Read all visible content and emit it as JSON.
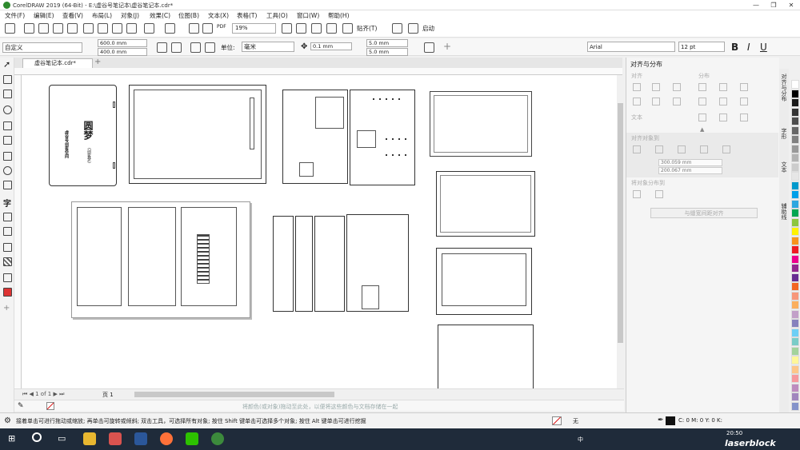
{
  "window": {
    "title": "CorelDRAW 2019 (64-Bit) - E:\\虚谷号笔记本\\虚谷笔记本.cdr*",
    "minimize": "—",
    "restore": "❐",
    "close": "✕"
  },
  "menu": [
    "文件(F)",
    "编辑(E)",
    "查看(V)",
    "布局(L)",
    "对象(J)",
    "效果(C)",
    "位图(B)",
    "文本(X)",
    "表格(T)",
    "工具(O)",
    "窗口(W)",
    "帮助(H)"
  ],
  "toolbar": {
    "zoom": "19%",
    "snap_label": "贴齐(T)",
    "launch_label": "启动",
    "pdf_label": "PDF"
  },
  "propbar": {
    "page_preset": "自定义",
    "width": "600.0 mm",
    "height": "400.0 mm",
    "unit_label": "单位:",
    "unit": "毫米",
    "nudge": "0.1 mm",
    "dup_x": "5.0 mm",
    "dup_y": "5.0 mm",
    "font": "Arial",
    "font_size": "12 pt",
    "bold": "B",
    "italic": "I",
    "underline": "U"
  },
  "tabs": {
    "doc": "虚谷笔记本.cdr*",
    "add": "+"
  },
  "docker": {
    "title": "对齐与分布",
    "align": "对齐",
    "distribute": "分布",
    "text": "文本",
    "align_objects": "对齐对象到",
    "box_w": "300.059 mm",
    "box_h": "200.067 mm",
    "dist_objects": "将对象分布到",
    "distribute_btn": "与缝宽间距对齐"
  },
  "docker_tabs": [
    "对齐与分布",
    "字形",
    "文本",
    "辅助线"
  ],
  "page_nav": "页 1",
  "color_hint": "将颜色(或对象)拖动至此处，以便将这些颜色与文档存储在一起",
  "status": {
    "message": "接着单击可进行拖动或缩放; 再单击可旋转或倾斜; 双击工具，可选择所有对象; 按住 Shift 键单击可选择多个对象; 按住 Alt 键单击可进行挖掘",
    "fill": "无",
    "outline": "C: 0 M: 0 Y: 0 K:"
  },
  "taskbar": {
    "ime": "中",
    "time": "20:50",
    "watermark": "laserblock"
  },
  "canvas_text": {
    "logo_big": "圆梦",
    "logo_small": "(创客梦)",
    "vertical": "虚谷号创客空间"
  },
  "palette_colors": [
    "#ffffff",
    "#000000",
    "#1a1a1a",
    "#333333",
    "#4d4d4d",
    "#666666",
    "#808080",
    "#999999",
    "#b3b3b3",
    "#cccccc",
    "#e6e6e6",
    "#0099cc",
    "#00a0e9",
    "#2ea7e0",
    "#00a651",
    "#8dc63f",
    "#fff200",
    "#f7941d",
    "#ed1c24",
    "#ec008c",
    "#92278f",
    "#662d91",
    "#f26522",
    "#f7977a",
    "#fbaf5d",
    "#c2a0c8",
    "#8781bd",
    "#6dcff6",
    "#7accc8",
    "#a3d39c",
    "#fff799",
    "#fdc689",
    "#f6989d",
    "#bd8cbf",
    "#a186be",
    "#8493ca"
  ]
}
